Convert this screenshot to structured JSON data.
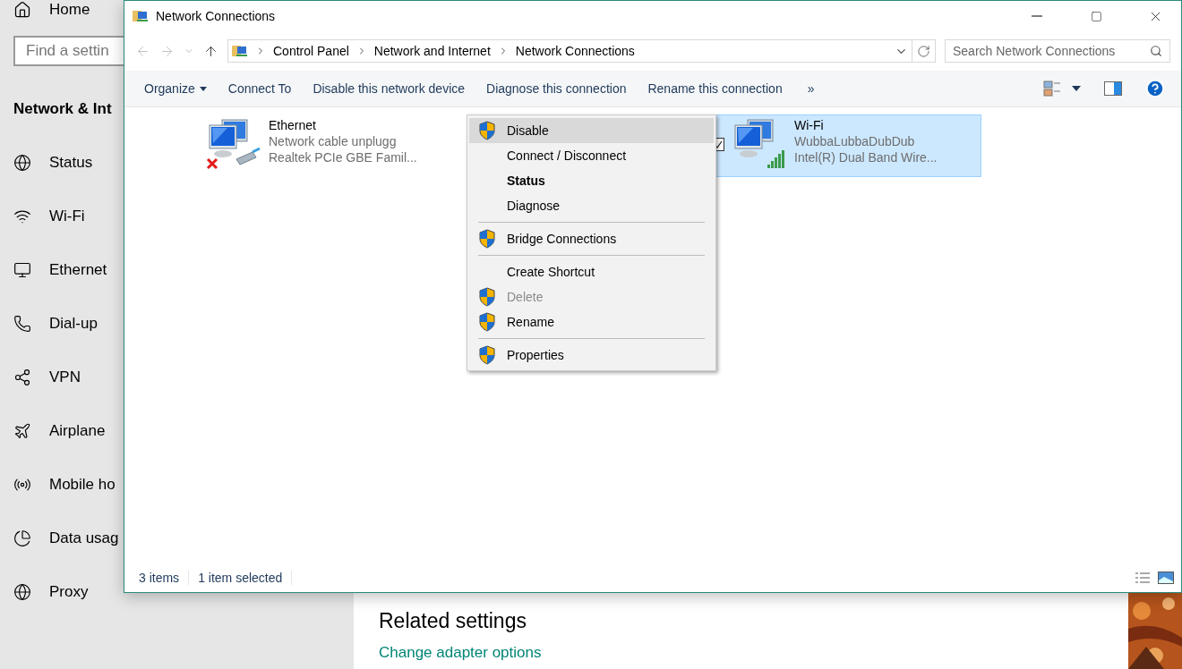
{
  "settings": {
    "home": "Home",
    "search": {
      "placeholder": "Find a settin"
    },
    "section": "Network & Int",
    "nav": [
      {
        "label": "Status"
      },
      {
        "label": "Wi-Fi"
      },
      {
        "label": "Ethernet"
      },
      {
        "label": "Dial-up"
      },
      {
        "label": "VPN"
      },
      {
        "label": "Airplane"
      },
      {
        "label": "Mobile ho"
      },
      {
        "label": "Data usag"
      },
      {
        "label": "Proxy"
      }
    ],
    "related_title": "Related settings",
    "related_link": "Change adapter options"
  },
  "window": {
    "title": "Network Connections",
    "breadcrumb": [
      "Control Panel",
      "Network and Internet",
      "Network Connections"
    ],
    "search": {
      "placeholder": "Search Network Connections"
    },
    "toolbar": [
      {
        "label": "Organize",
        "dropdown": true
      },
      {
        "label": "Connect To",
        "dropdown": false
      },
      {
        "label": "Disable this network device",
        "dropdown": false
      },
      {
        "label": "Diagnose this connection",
        "dropdown": false
      },
      {
        "label": "Rename this connection",
        "dropdown": false
      },
      {
        "label": "»",
        "dropdown": false
      }
    ],
    "connections": [
      {
        "name": "Ethernet",
        "status": "Network cable unplugg",
        "adapter": "Realtek PCIe GBE Famil...",
        "kind": "wired",
        "connected": false,
        "selected": false,
        "checked": false
      },
      {
        "name": "Wi-Fi",
        "status": "WubbaLubbaDubDub",
        "adapter": "Intel(R) Dual Band Wire...",
        "kind": "wireless",
        "connected": true,
        "selected": true,
        "checked": true
      }
    ],
    "status_bar": [
      "3 items",
      "1 item selected"
    ]
  },
  "context_menu": [
    {
      "kind": "item",
      "label": "Disable",
      "shield": true,
      "bold": false,
      "disabled": false,
      "selected": true
    },
    {
      "kind": "item",
      "label": "Connect / Disconnect",
      "shield": false,
      "bold": false,
      "disabled": false,
      "selected": false
    },
    {
      "kind": "item",
      "label": "Status",
      "shield": false,
      "bold": true,
      "disabled": false,
      "selected": false
    },
    {
      "kind": "item",
      "label": "Diagnose",
      "shield": false,
      "bold": false,
      "disabled": false,
      "selected": false
    },
    {
      "kind": "separator"
    },
    {
      "kind": "item",
      "label": "Bridge Connections",
      "shield": true,
      "bold": false,
      "disabled": false,
      "selected": false
    },
    {
      "kind": "separator"
    },
    {
      "kind": "item",
      "label": "Create Shortcut",
      "shield": false,
      "bold": false,
      "disabled": false,
      "selected": false
    },
    {
      "kind": "item",
      "label": "Delete",
      "shield": true,
      "bold": false,
      "disabled": true,
      "selected": false
    },
    {
      "kind": "item",
      "label": "Rename",
      "shield": true,
      "bold": false,
      "disabled": false,
      "selected": false
    },
    {
      "kind": "separator"
    },
    {
      "kind": "item",
      "label": "Properties",
      "shield": true,
      "bold": false,
      "disabled": false,
      "selected": false
    }
  ]
}
